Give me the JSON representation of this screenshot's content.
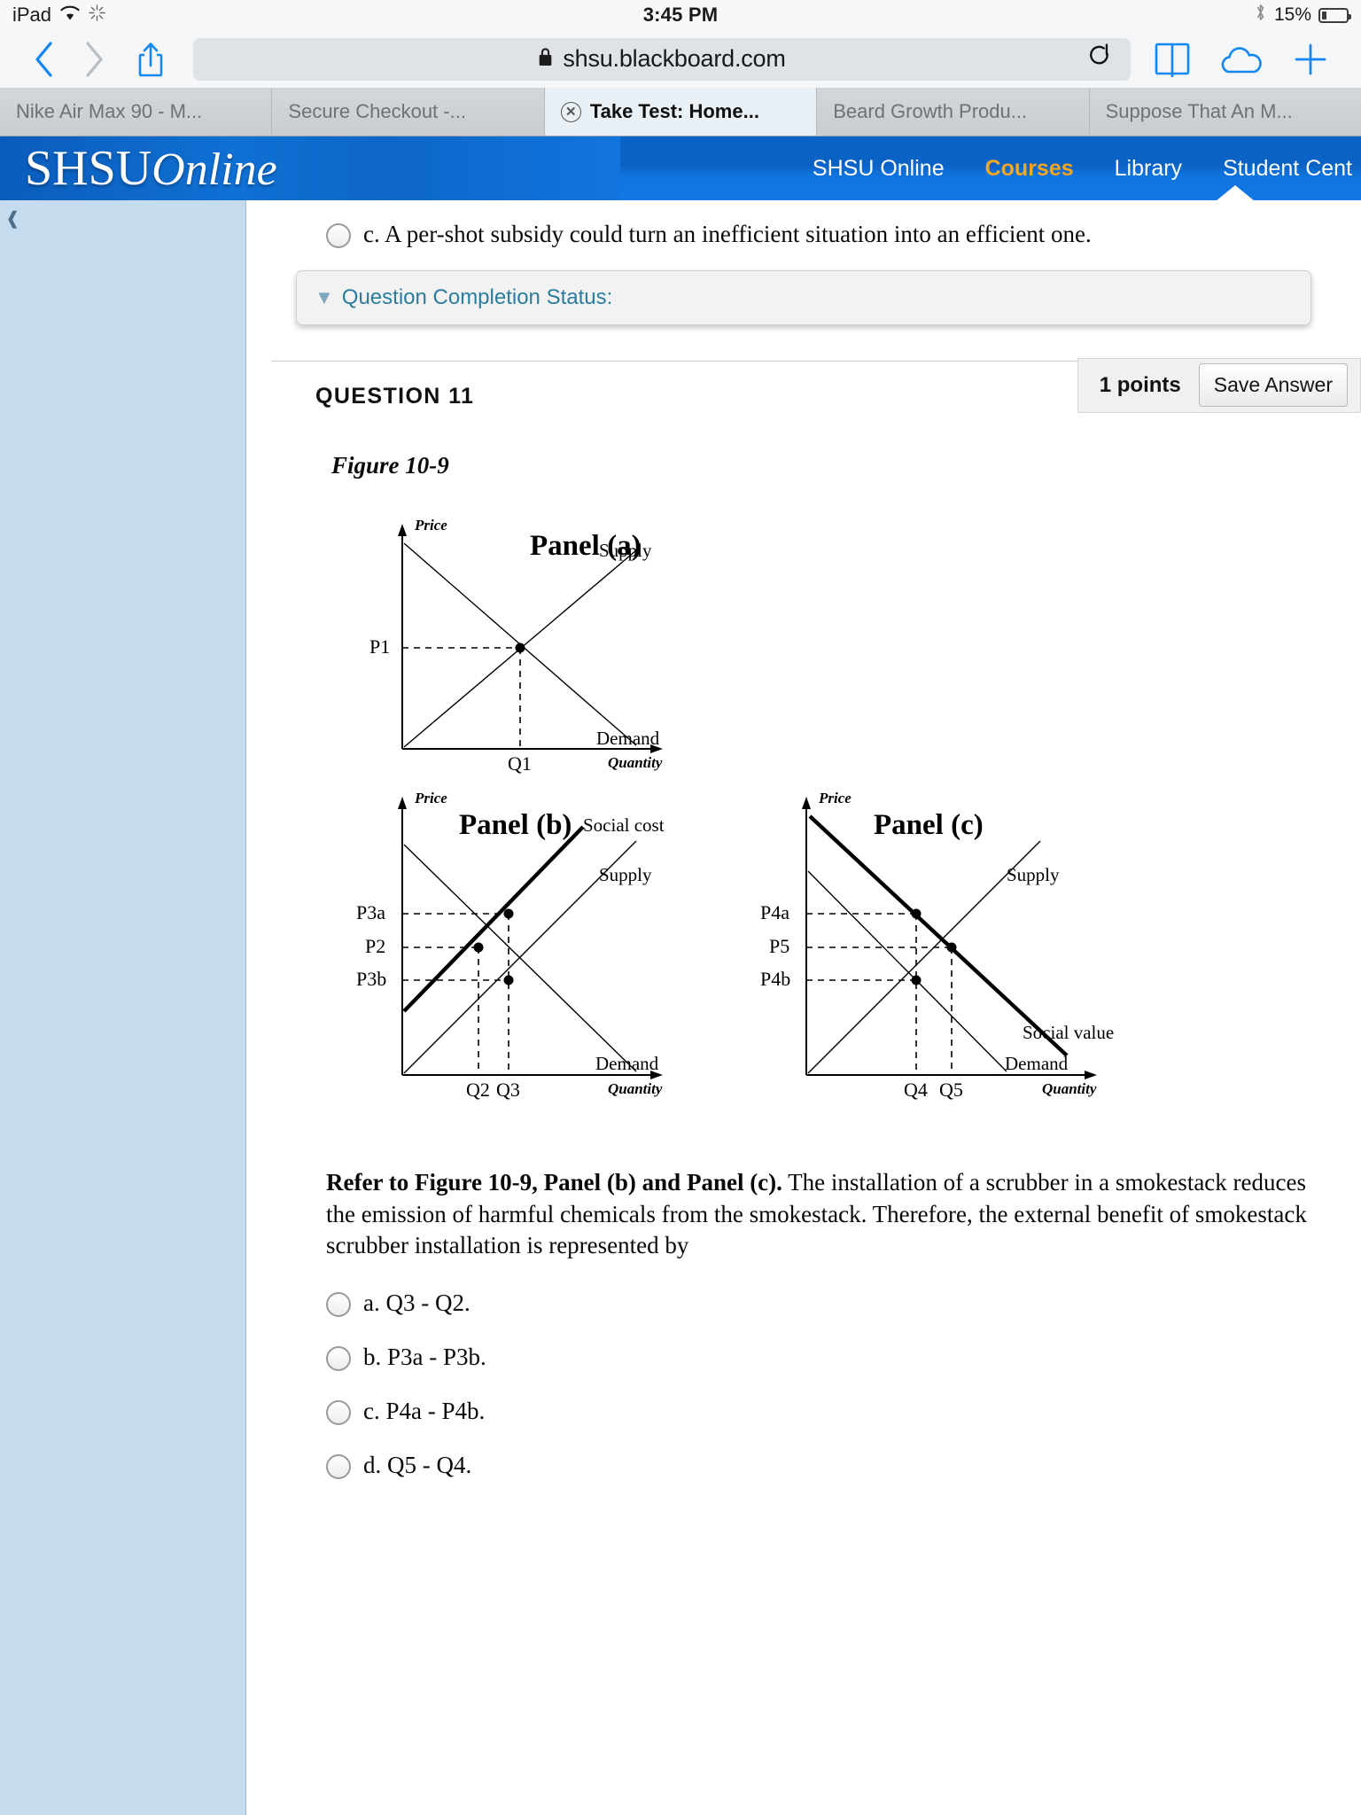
{
  "status_bar": {
    "device": "iPad",
    "wifi_icon": "wifi-icon",
    "brightness_icon": "brightness-icon",
    "time": "3:45 PM",
    "bluetooth_icon": "bluetooth-icon",
    "battery_percent": "15%",
    "battery_icon": "battery-icon"
  },
  "browser": {
    "back_icon": "chevron-left-icon",
    "forward_icon": "chevron-right-icon",
    "share_icon": "share-icon",
    "lock_icon": "lock-icon",
    "url": "shsu.blackboard.com",
    "reload_icon": "reload-icon",
    "bookmarks_icon": "book-icon",
    "icloud_tabs_icon": "cloud-icon",
    "new_tab_icon": "plus-icon",
    "tabs": [
      {
        "label": "Nike Air Max 90 - M...",
        "active": false
      },
      {
        "label": "Secure Checkout -...",
        "active": false
      },
      {
        "label": "Take Test: Home...",
        "active": true
      },
      {
        "label": "Beard Growth Produ...",
        "active": false
      },
      {
        "label": "Suppose That An M...",
        "active": false
      }
    ],
    "close_icon": "close-icon"
  },
  "site": {
    "brand_shsu": "SHSU",
    "brand_online": "Online",
    "nav": [
      {
        "label": "SHSU Online",
        "active": false
      },
      {
        "label": "Courses",
        "active": true
      },
      {
        "label": "Library",
        "active": false
      },
      {
        "label": "Student Cent",
        "active": false
      }
    ],
    "accent_color": "#f5a623",
    "header_color": "#0b63c6"
  },
  "previous_question": {
    "option_c": "c. A per-shot subsidy could turn an inefficient situation into an efficient one."
  },
  "completion_status": {
    "chevron_icon": "chevron-double-down-icon",
    "label": "Question Completion Status:"
  },
  "question": {
    "title": "QUESTION 11",
    "points": "1 points",
    "save_label": "Save Answer",
    "figure_label": "Figure 10-9",
    "prompt_bold": "Refer to Figure 10-9, Panel (b) and Panel (c).",
    "prompt_rest": " The installation of a scrubber in a smokestack reduces the emission of harmful chemicals from the smokestack. Therefore, the external benefit of smokestack scrubber installation is represented by",
    "options": [
      "a. Q3 - Q2.",
      "b. P3a - P3b.",
      "c. P4a - P4b.",
      "d. Q5 - Q4."
    ]
  },
  "chart_data": [
    {
      "type": "line",
      "title": "Panel (a)",
      "xlabel": "Quantity",
      "ylabel": "Price",
      "series": [
        {
          "name": "Demand",
          "note": "downward sloping demand curve"
        },
        {
          "name": "Supply",
          "note": "upward sloping supply curve"
        }
      ],
      "equilibrium_points": [
        {
          "price_label": "P1",
          "quantity_label": "Q1"
        }
      ],
      "tick_labels_y": [
        "P1"
      ],
      "tick_labels_x": [
        "Q1"
      ],
      "legend": [
        "Supply",
        "Demand"
      ]
    },
    {
      "type": "line",
      "title": "Panel (b)",
      "xlabel": "Quantity",
      "ylabel": "Price",
      "series": [
        {
          "name": "Social cost",
          "note": "bold upward sloping curve above supply"
        },
        {
          "name": "Supply",
          "note": "upward sloping private supply curve"
        },
        {
          "name": "Demand",
          "note": "downward sloping demand curve"
        }
      ],
      "equilibrium_points": [
        {
          "price_label": "P3a",
          "quantity_label": "Q2"
        },
        {
          "price_label": "P2",
          "quantity_label": "Q2"
        },
        {
          "price_label": "P3b",
          "quantity_label": "Q3"
        }
      ],
      "tick_labels_y": [
        "P3a",
        "P2",
        "P3b"
      ],
      "tick_labels_x": [
        "Q2",
        "Q3"
      ],
      "legend": [
        "Social cost",
        "Supply",
        "Demand"
      ]
    },
    {
      "type": "line",
      "title": "Panel (c)",
      "xlabel": "Quantity",
      "ylabel": "Price",
      "series": [
        {
          "name": "Social value",
          "note": "bold downward sloping curve above demand"
        },
        {
          "name": "Supply",
          "note": "upward sloping supply curve"
        },
        {
          "name": "Demand",
          "note": "downward sloping private demand curve"
        }
      ],
      "equilibrium_points": [
        {
          "price_label": "P4a",
          "quantity_label": "Q4"
        },
        {
          "price_label": "P5",
          "quantity_label": "Q5"
        },
        {
          "price_label": "P4b",
          "quantity_label": "Q4"
        }
      ],
      "tick_labels_y": [
        "P4a",
        "P5",
        "P4b"
      ],
      "tick_labels_x": [
        "Q4",
        "Q5"
      ],
      "legend": [
        "Supply",
        "Social value",
        "Demand"
      ]
    }
  ]
}
